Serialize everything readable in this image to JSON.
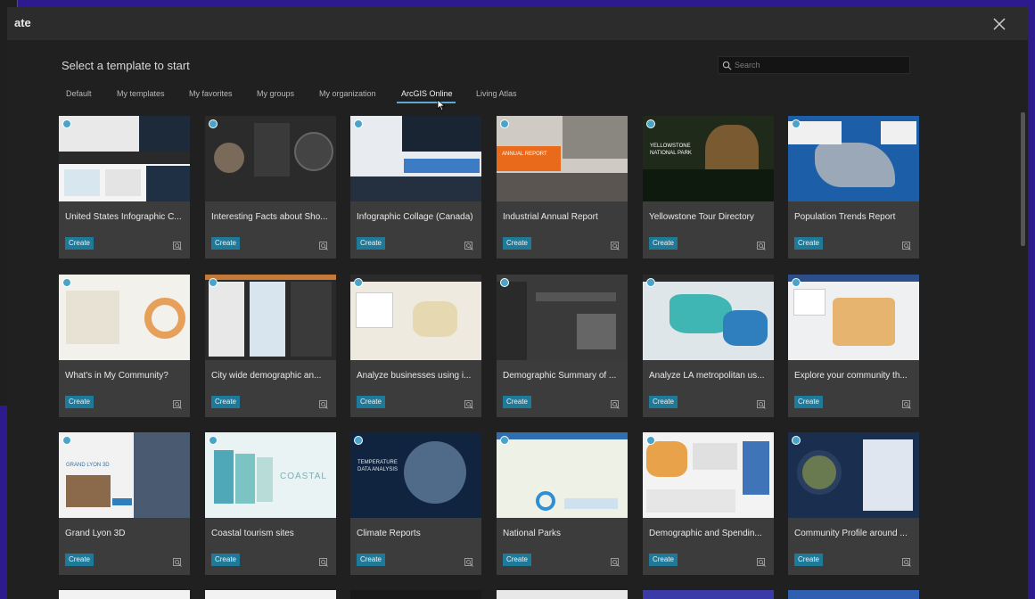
{
  "window": {
    "title_fragment": "ate"
  },
  "heading": "Select a template to start",
  "search": {
    "placeholder": "Search",
    "value": ""
  },
  "tabs": [
    {
      "label": "Default",
      "active": false
    },
    {
      "label": "My templates",
      "active": false
    },
    {
      "label": "My favorites",
      "active": false
    },
    {
      "label": "My groups",
      "active": false
    },
    {
      "label": "My organization",
      "active": false
    },
    {
      "label": "ArcGIS Online",
      "active": true
    },
    {
      "label": "Living Atlas",
      "active": false
    }
  ],
  "create_label": "Create",
  "colors": {
    "accent": "#1f7a9a",
    "tab_underline": "#5fa8d3",
    "backdrop": "#2e1a8f",
    "card": "#3c3c3c"
  },
  "templates": [
    {
      "title": "United States Infographic C...",
      "thumb": "infographic-white"
    },
    {
      "title": "Interesting Facts about Sho...",
      "thumb": "dark-circles"
    },
    {
      "title": "Infographic Collage (Canada)",
      "thumb": "collage-blue"
    },
    {
      "title": "Industrial Annual Report",
      "thumb": "annual-report"
    },
    {
      "title": "Yellowstone Tour Directory",
      "thumb": "yellowstone"
    },
    {
      "title": "Population Trends Report",
      "thumb": "blue-map"
    },
    {
      "title": "What's in My Community?",
      "thumb": "community-chart"
    },
    {
      "title": "City wide demographic an...",
      "thumb": "city-panels"
    },
    {
      "title": "Analyze businesses using i...",
      "thumb": "light-map"
    },
    {
      "title": "Demographic Summary of ...",
      "thumb": "dark-dashboard"
    },
    {
      "title": "Analyze LA metropolitan us...",
      "thumb": "la-map"
    },
    {
      "title": "Explore your community th...",
      "thumb": "orange-map"
    },
    {
      "title": "Grand Lyon 3D",
      "thumb": "lyon"
    },
    {
      "title": "Coastal tourism sites",
      "thumb": "coastal"
    },
    {
      "title": "Climate Reports",
      "thumb": "climate"
    },
    {
      "title": "National Parks",
      "thumb": "parks"
    },
    {
      "title": "Demographic and Spendin...",
      "thumb": "spending"
    },
    {
      "title": "Community Profile around ...",
      "thumb": "profile"
    }
  ],
  "thumb_text": {
    "annual_report": "ANNUAL REPORT",
    "yellowstone": "YELLOWSTONE NATIONAL PARK",
    "coastal": "COASTAL",
    "lyon": "GRAND LYON 3D",
    "climate": "TEMPERATURE DATA ANALYSIS"
  }
}
